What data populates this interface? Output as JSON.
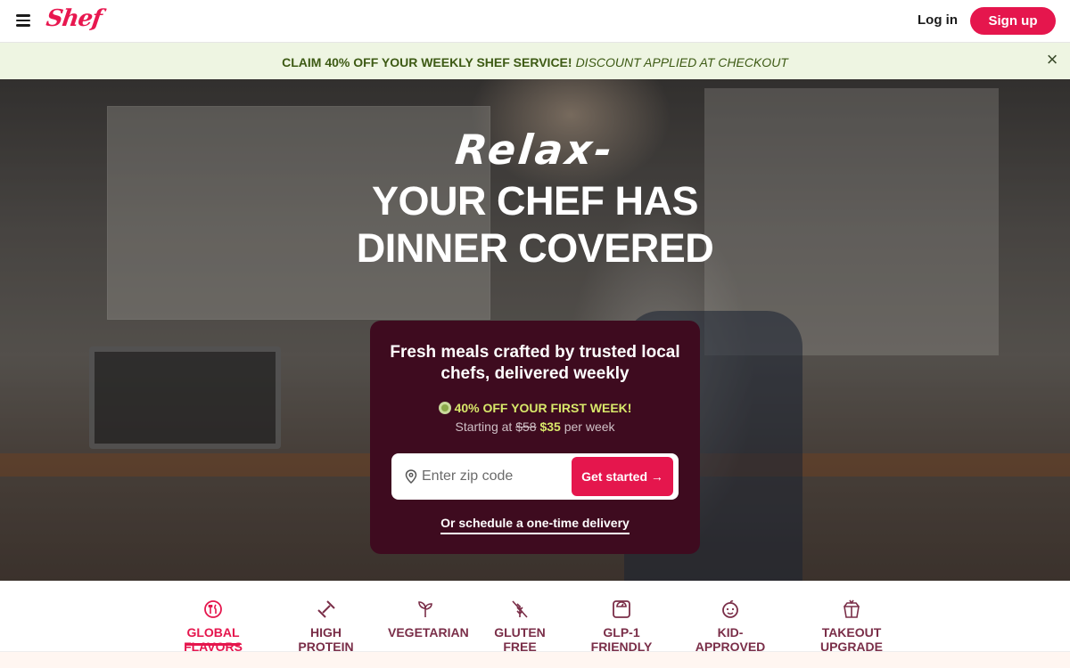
{
  "header": {
    "logo_text": "Shef",
    "login_label": "Log in",
    "signup_label": "Sign up",
    "brand_color": "#e5164d"
  },
  "promo": {
    "main_text": "CLAIM 40% OFF YOUR WEEKLY SHEF SERVICE!",
    "sub_text": "DISCOUNT APPLIED AT CHECKOUT",
    "close_icon": "close-icon"
  },
  "hero": {
    "script_text": "Relax-",
    "headline_line1": "YOUR CHEF HAS",
    "headline_line2": "DINNER COVERED"
  },
  "card": {
    "title": "Fresh meals crafted by trusted local chefs, delivered weekly",
    "offer": "40% OFF YOUR FIRST WEEK!",
    "price_prefix": "Starting at",
    "price_old": "$58",
    "price_new": "$35",
    "price_suffix": "per week",
    "zip_placeholder": "Enter zip code",
    "cta_label": "Get started →",
    "secondary_link": "Or schedule a one-time delivery"
  },
  "categories": [
    {
      "label": "GLOBAL FLAVORS",
      "icon": "globe-fork-icon",
      "active": true
    },
    {
      "label": "HIGH PROTEIN",
      "icon": "dumbbell-icon",
      "active": false
    },
    {
      "label": "VEGETARIAN",
      "icon": "sprout-icon",
      "active": false
    },
    {
      "label": "GLUTEN FREE",
      "icon": "wheat-off-icon",
      "active": false
    },
    {
      "label": "GLP-1 FRIENDLY",
      "icon": "scale-icon",
      "active": false
    },
    {
      "label": "KID-APPROVED",
      "icon": "smiley-face-icon",
      "active": false
    },
    {
      "label": "TAKEOUT UPGRADE",
      "icon": "takeout-box-icon",
      "active": false
    }
  ]
}
